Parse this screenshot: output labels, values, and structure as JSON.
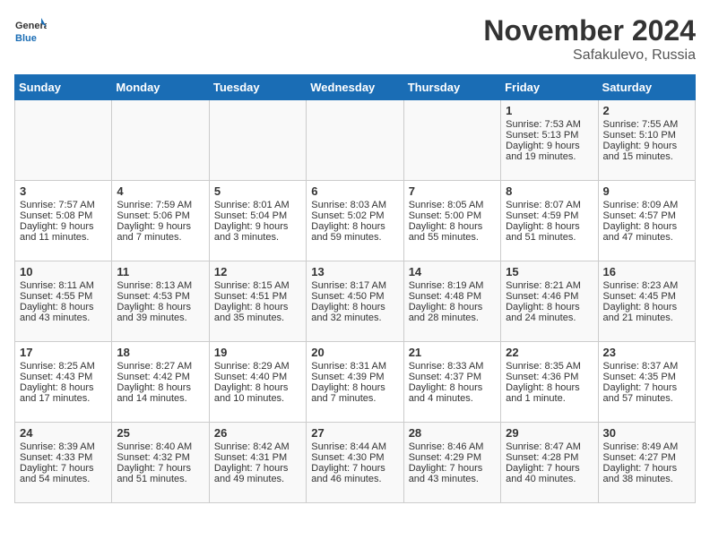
{
  "logo": {
    "line1": "General",
    "line2": "Blue"
  },
  "title": "November 2024",
  "location": "Safakulevo, Russia",
  "days_header": [
    "Sunday",
    "Monday",
    "Tuesday",
    "Wednesday",
    "Thursday",
    "Friday",
    "Saturday"
  ],
  "weeks": [
    [
      {
        "day": "",
        "info": ""
      },
      {
        "day": "",
        "info": ""
      },
      {
        "day": "",
        "info": ""
      },
      {
        "day": "",
        "info": ""
      },
      {
        "day": "",
        "info": ""
      },
      {
        "day": "1",
        "info": "Sunrise: 7:53 AM\nSunset: 5:13 PM\nDaylight: 9 hours and 19 minutes."
      },
      {
        "day": "2",
        "info": "Sunrise: 7:55 AM\nSunset: 5:10 PM\nDaylight: 9 hours and 15 minutes."
      }
    ],
    [
      {
        "day": "3",
        "info": "Sunrise: 7:57 AM\nSunset: 5:08 PM\nDaylight: 9 hours and 11 minutes."
      },
      {
        "day": "4",
        "info": "Sunrise: 7:59 AM\nSunset: 5:06 PM\nDaylight: 9 hours and 7 minutes."
      },
      {
        "day": "5",
        "info": "Sunrise: 8:01 AM\nSunset: 5:04 PM\nDaylight: 9 hours and 3 minutes."
      },
      {
        "day": "6",
        "info": "Sunrise: 8:03 AM\nSunset: 5:02 PM\nDaylight: 8 hours and 59 minutes."
      },
      {
        "day": "7",
        "info": "Sunrise: 8:05 AM\nSunset: 5:00 PM\nDaylight: 8 hours and 55 minutes."
      },
      {
        "day": "8",
        "info": "Sunrise: 8:07 AM\nSunset: 4:59 PM\nDaylight: 8 hours and 51 minutes."
      },
      {
        "day": "9",
        "info": "Sunrise: 8:09 AM\nSunset: 4:57 PM\nDaylight: 8 hours and 47 minutes."
      }
    ],
    [
      {
        "day": "10",
        "info": "Sunrise: 8:11 AM\nSunset: 4:55 PM\nDaylight: 8 hours and 43 minutes."
      },
      {
        "day": "11",
        "info": "Sunrise: 8:13 AM\nSunset: 4:53 PM\nDaylight: 8 hours and 39 minutes."
      },
      {
        "day": "12",
        "info": "Sunrise: 8:15 AM\nSunset: 4:51 PM\nDaylight: 8 hours and 35 minutes."
      },
      {
        "day": "13",
        "info": "Sunrise: 8:17 AM\nSunset: 4:50 PM\nDaylight: 8 hours and 32 minutes."
      },
      {
        "day": "14",
        "info": "Sunrise: 8:19 AM\nSunset: 4:48 PM\nDaylight: 8 hours and 28 minutes."
      },
      {
        "day": "15",
        "info": "Sunrise: 8:21 AM\nSunset: 4:46 PM\nDaylight: 8 hours and 24 minutes."
      },
      {
        "day": "16",
        "info": "Sunrise: 8:23 AM\nSunset: 4:45 PM\nDaylight: 8 hours and 21 minutes."
      }
    ],
    [
      {
        "day": "17",
        "info": "Sunrise: 8:25 AM\nSunset: 4:43 PM\nDaylight: 8 hours and 17 minutes."
      },
      {
        "day": "18",
        "info": "Sunrise: 8:27 AM\nSunset: 4:42 PM\nDaylight: 8 hours and 14 minutes."
      },
      {
        "day": "19",
        "info": "Sunrise: 8:29 AM\nSunset: 4:40 PM\nDaylight: 8 hours and 10 minutes."
      },
      {
        "day": "20",
        "info": "Sunrise: 8:31 AM\nSunset: 4:39 PM\nDaylight: 8 hours and 7 minutes."
      },
      {
        "day": "21",
        "info": "Sunrise: 8:33 AM\nSunset: 4:37 PM\nDaylight: 8 hours and 4 minutes."
      },
      {
        "day": "22",
        "info": "Sunrise: 8:35 AM\nSunset: 4:36 PM\nDaylight: 8 hours and 1 minute."
      },
      {
        "day": "23",
        "info": "Sunrise: 8:37 AM\nSunset: 4:35 PM\nDaylight: 7 hours and 57 minutes."
      }
    ],
    [
      {
        "day": "24",
        "info": "Sunrise: 8:39 AM\nSunset: 4:33 PM\nDaylight: 7 hours and 54 minutes."
      },
      {
        "day": "25",
        "info": "Sunrise: 8:40 AM\nSunset: 4:32 PM\nDaylight: 7 hours and 51 minutes."
      },
      {
        "day": "26",
        "info": "Sunrise: 8:42 AM\nSunset: 4:31 PM\nDaylight: 7 hours and 49 minutes."
      },
      {
        "day": "27",
        "info": "Sunrise: 8:44 AM\nSunset: 4:30 PM\nDaylight: 7 hours and 46 minutes."
      },
      {
        "day": "28",
        "info": "Sunrise: 8:46 AM\nSunset: 4:29 PM\nDaylight: 7 hours and 43 minutes."
      },
      {
        "day": "29",
        "info": "Sunrise: 8:47 AM\nSunset: 4:28 PM\nDaylight: 7 hours and 40 minutes."
      },
      {
        "day": "30",
        "info": "Sunrise: 8:49 AM\nSunset: 4:27 PM\nDaylight: 7 hours and 38 minutes."
      }
    ]
  ]
}
